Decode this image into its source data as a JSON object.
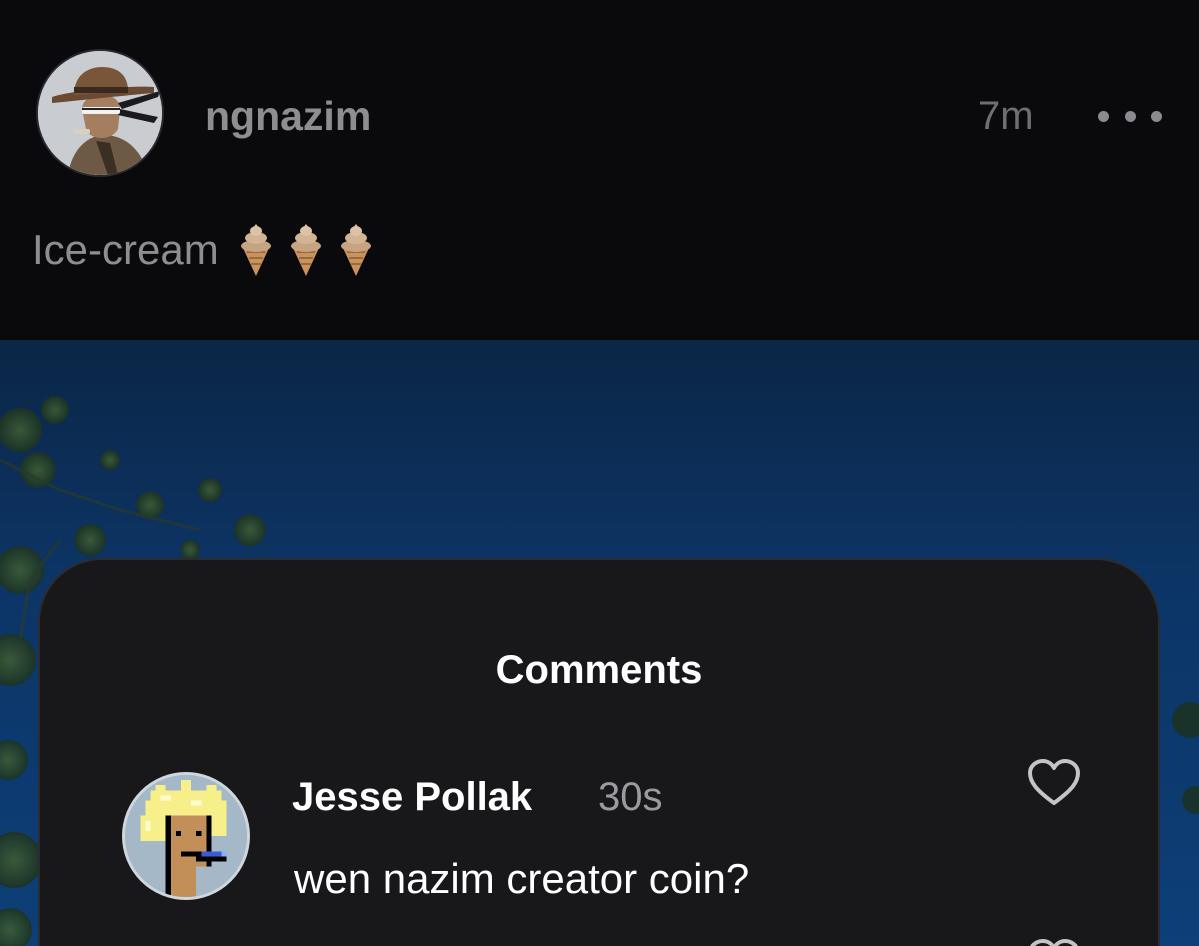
{
  "post": {
    "author": "ngnazim",
    "time_ago": "7m",
    "caption": "Ice-cream",
    "caption_emoji": [
      "ice-cream-cone",
      "ice-cream-cone",
      "ice-cream-cone"
    ]
  },
  "comments_sheet": {
    "title": "Comments",
    "comments": [
      {
        "author": "Jesse Pollak",
        "time_ago": "30s",
        "text": "wen nazim creator coin?"
      }
    ]
  },
  "colors": {
    "background": "#0a0a0c",
    "sheet": "#18181b",
    "sky": "#0d3f78",
    "muted_text": "#8d8d92"
  },
  "icons": {
    "more": "ellipsis-icon",
    "like": "heart-outline-icon"
  }
}
